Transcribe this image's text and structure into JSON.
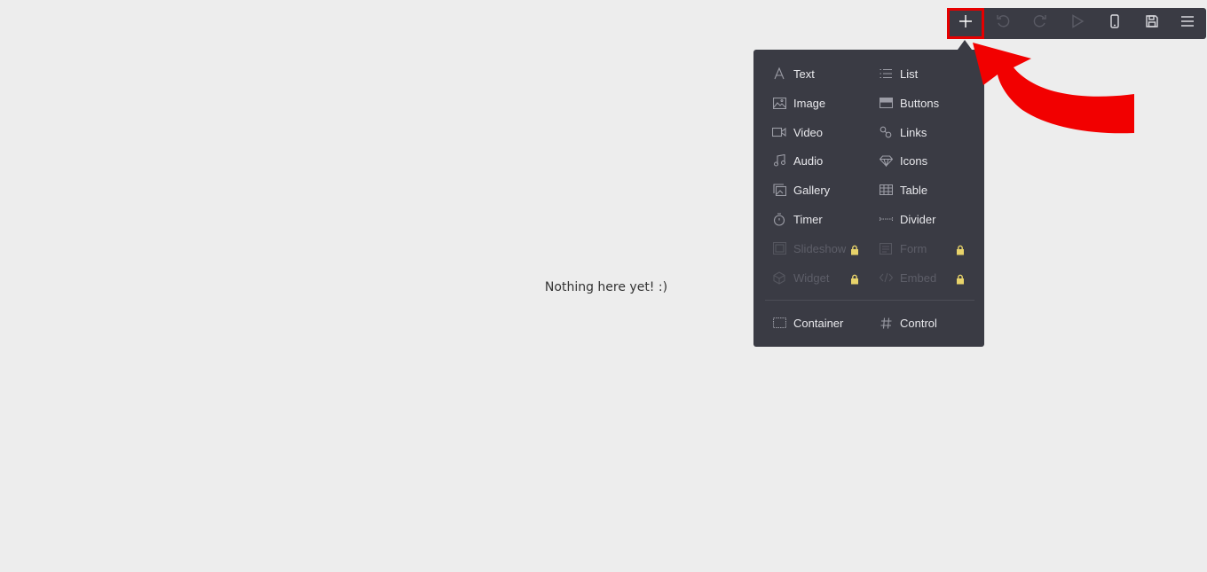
{
  "canvas": {
    "empty_message": "Nothing here yet! :)"
  },
  "toolbar": {
    "buttons": [
      {
        "name": "add",
        "icon": "plus-icon",
        "active": true
      },
      {
        "name": "undo",
        "icon": "undo-icon",
        "disabled": true
      },
      {
        "name": "redo",
        "icon": "redo-icon",
        "disabled": true
      },
      {
        "name": "preview",
        "icon": "play-icon",
        "disabled": true
      },
      {
        "name": "mobile",
        "icon": "phone-icon"
      },
      {
        "name": "save",
        "icon": "save-icon"
      },
      {
        "name": "menu",
        "icon": "hamburger-icon"
      }
    ]
  },
  "menu": {
    "left": [
      {
        "label": "Text",
        "icon": "text-icon"
      },
      {
        "label": "Image",
        "icon": "image-icon"
      },
      {
        "label": "Video",
        "icon": "video-icon"
      },
      {
        "label": "Audio",
        "icon": "music-icon"
      },
      {
        "label": "Gallery",
        "icon": "gallery-icon"
      },
      {
        "label": "Timer",
        "icon": "timer-icon"
      },
      {
        "label": "Slideshow",
        "icon": "slideshow-icon",
        "locked": true
      },
      {
        "label": "Widget",
        "icon": "widget-icon",
        "locked": true
      }
    ],
    "right": [
      {
        "label": "List",
        "icon": "list-icon"
      },
      {
        "label": "Buttons",
        "icon": "buttons-icon"
      },
      {
        "label": "Links",
        "icon": "link-icon"
      },
      {
        "label": "Icons",
        "icon": "diamond-icon"
      },
      {
        "label": "Table",
        "icon": "table-icon"
      },
      {
        "label": "Divider",
        "icon": "divider-icon"
      },
      {
        "label": "Form",
        "icon": "form-icon",
        "locked": true
      },
      {
        "label": "Embed",
        "icon": "code-icon",
        "locked": true
      }
    ],
    "bottom": [
      {
        "label": "Container",
        "icon": "container-icon"
      },
      {
        "label": "Control",
        "icon": "hash-icon"
      }
    ]
  },
  "colors": {
    "panel": "#3a3b44",
    "highlight": "#e60000",
    "lock": "#e8d36a"
  }
}
